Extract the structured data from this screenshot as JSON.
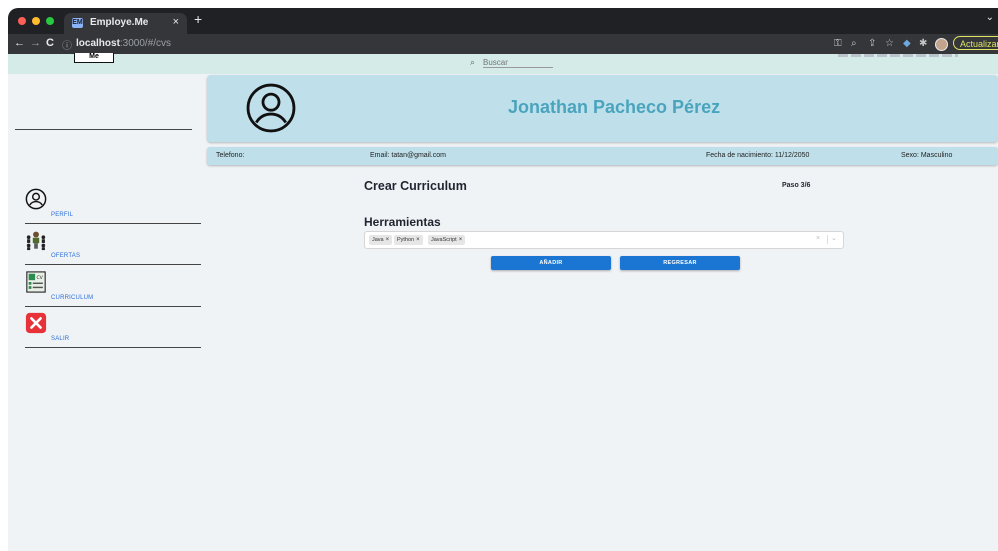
{
  "browser": {
    "tab_title": "Employe.Me",
    "tab_favicon": "EM",
    "tab_close": "×",
    "new_tab": "+",
    "tab_menu": "⌄",
    "url_host": "localhost",
    "url_path": ":3000/#/cvs",
    "update_button": "Actualizar",
    "nav": {
      "back": "←",
      "forward": "→",
      "reload": "C",
      "info": "ⓘ"
    },
    "icons": [
      "key-icon",
      "zoom-icon",
      "share-icon",
      "star-icon",
      "extension-icon",
      "puzzle-icon",
      "profile-avatar"
    ]
  },
  "header": {
    "logo_text": "Me",
    "search_placeholder": "Buscar"
  },
  "sidebar": {
    "items": [
      {
        "label": "PERFIL",
        "icon": "user-circle-icon"
      },
      {
        "label": "OFERTAS",
        "icon": "people-icon"
      },
      {
        "label": "CURRICULUM",
        "icon": "cv-document-icon"
      },
      {
        "label": "SALIR",
        "icon": "close-x-icon"
      }
    ]
  },
  "profile": {
    "name": "Jonathan Pacheco Pérez",
    "phone": "Telefono:",
    "email": "Email: tatan@gmail.com",
    "birth": "Fecha de nacimiento: 11/12/2050",
    "sex": "Sexo: Masculino"
  },
  "form": {
    "title": "Crear Curriculum",
    "step": "Paso 3/6",
    "section": "Herramientas",
    "tags": [
      "Java",
      "Python",
      "JavaScript"
    ],
    "tag_remove": "×",
    "clear": "×",
    "dropdown": "⌄",
    "add_button": "AÑADIR",
    "back_button": "REGRESAR"
  },
  "colors": {
    "banner": "#bfe0ea",
    "name": "#4aa4bd",
    "button": "#1a76d2",
    "link": "#2a6fd6"
  }
}
